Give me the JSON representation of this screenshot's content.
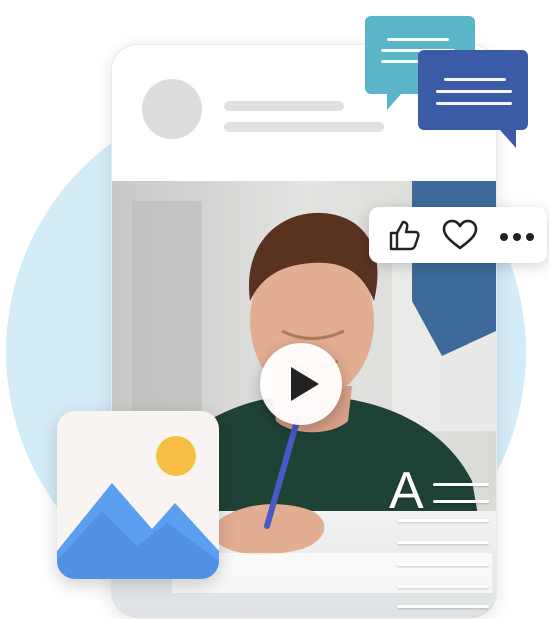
{
  "illustration": {
    "colors": {
      "background_circle": "#d3ecf8",
      "bubble_teal": "#5bb5c8",
      "bubble_navy": "#3b5ba7",
      "sun": "#f7bd47",
      "mountain": "#5c9ef0",
      "sweater": "#1f4236"
    },
    "post": {
      "avatar": "avatar-placeholder",
      "media": "photo-of-student-writing"
    },
    "reactions": [
      {
        "icon": "thumbs-up-icon"
      },
      {
        "icon": "heart-icon"
      },
      {
        "icon": "more-options-icon"
      }
    ],
    "media_controls": {
      "icon": "play-icon"
    },
    "text_icon": {
      "letter": "A"
    }
  }
}
